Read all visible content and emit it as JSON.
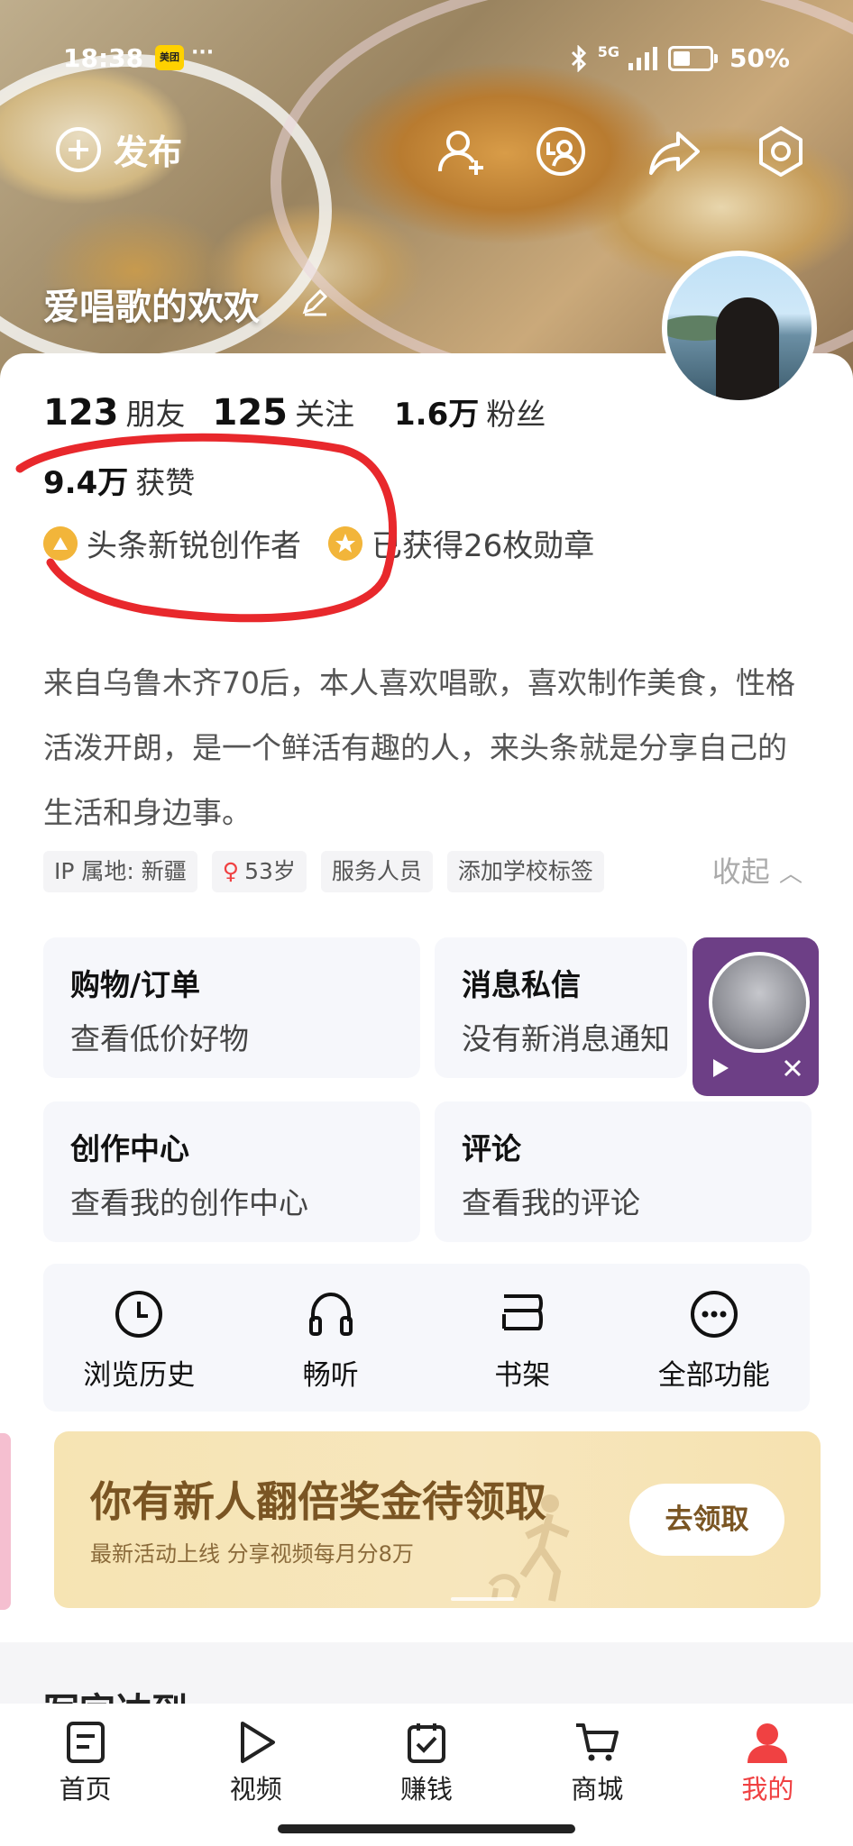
{
  "status_bar": {
    "time": "18:38",
    "app_badge": "美团",
    "signal": "5G",
    "battery": "50%"
  },
  "header": {
    "publish_label": "发布",
    "username": "爱唱歌的欢欢"
  },
  "profile": {
    "friends_count": "123",
    "friends_label": "朋友",
    "following_count": "125",
    "following_label": "关注",
    "fans_count": "1.6万",
    "fans_label": "粉丝",
    "likes_count": "9.4万",
    "likes_label": "获赞",
    "creator_badge": "头条新锐创作者",
    "medals": "已获得26枚勋章",
    "bio": "来自乌鲁木齐70后，本人喜欢唱歌，喜欢制作美食，性格活泼开朗，是一个鲜活有趣的人，来头条就是分享自己的生活和身边事。",
    "tags": [
      "IP 属地: 新疆",
      "53岁",
      "服务人员",
      "添加学校标签"
    ],
    "collapse_label": "收起"
  },
  "tiles": [
    {
      "title": "购物/订单",
      "subtitle": "查看低价好物"
    },
    {
      "title": "消息私信",
      "subtitle": "没有新消息通知"
    },
    {
      "title": "创作中心",
      "subtitle": "查看我的创作中心"
    },
    {
      "title": "评论",
      "subtitle": "查看我的评论"
    }
  ],
  "shortcuts": [
    "浏览历史",
    "畅听",
    "书架",
    "全部功能"
  ],
  "promo": {
    "title": "你有新人翻倍奖金待领取",
    "subtitle": "最新活动上线 分享视频每月分8万",
    "button": "去领取"
  },
  "section_peek": "写字达到",
  "bottom_nav": [
    "首页",
    "视频",
    "赚钱",
    "商城",
    "我的"
  ],
  "colors": {
    "accent": "#f04142",
    "promo_text": "#7a5523",
    "float_player": "#6d3f86",
    "annotation": "#e8282c"
  }
}
